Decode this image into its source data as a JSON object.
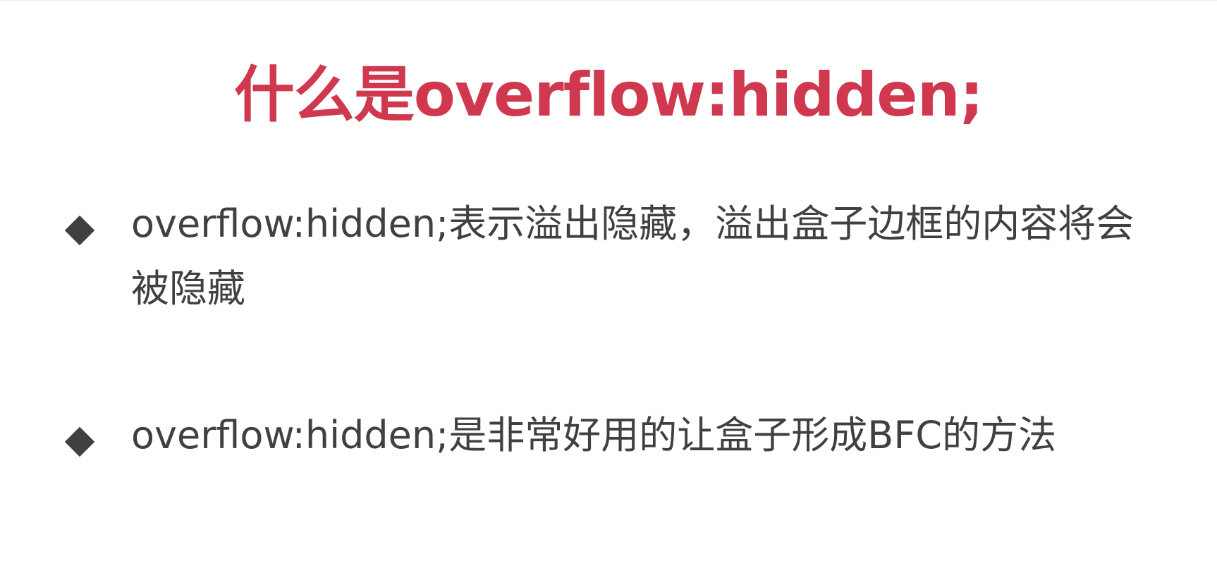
{
  "slide": {
    "title": "什么是overflow:hidden;",
    "bullets": [
      {
        "text": "overflow:hidden;表示溢出隐藏，溢出盒子边框的内容将会被隐藏"
      },
      {
        "text": "overflow:hidden;是非常好用的让盒子形成BFC的方法"
      }
    ]
  },
  "colors": {
    "title": "#d0384f",
    "body_text": "#404040",
    "bullet_marker": "#404040",
    "background": "#ffffff"
  },
  "icons": {
    "bullet_marker": "diamond-icon"
  }
}
